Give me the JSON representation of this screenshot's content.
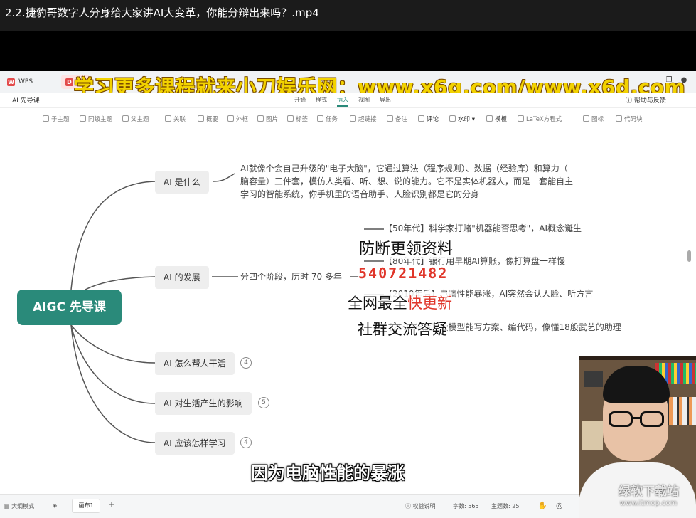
{
  "video": {
    "title": "2.2.捷豹哥数字人分身给大家讲AI大变革，你能分辩出来吗？.mp4"
  },
  "watermark": "学习更多课程就来小刀娱乐网：www.x6g.com/www.x6d.com",
  "titlebar": {
    "tabs": [
      {
        "label": "WPS Office",
        "icon": "wps-logo-icon"
      },
      {
        "label": "",
        "icon": "document-icon"
      }
    ]
  },
  "menubar": {
    "doc_name": "AI 先导课",
    "items": [
      "开始",
      "样式",
      "插入",
      "视图",
      "导出"
    ],
    "active": "插入",
    "help": "帮助与反馈"
  },
  "toolbar": {
    "items": [
      "子主题",
      "同级主题",
      "父主题",
      "关联",
      "概要",
      "外框",
      "图片",
      "标签",
      "任务",
      "超链接",
      "备注",
      "评论",
      "水印",
      "模板",
      "LaTeX方程式",
      "图标",
      "代码块"
    ]
  },
  "mindmap": {
    "root": "AIGC 先导课",
    "branches": [
      {
        "label": "AI 是什么",
        "count": null
      },
      {
        "label": "AI 的发展",
        "count": null
      },
      {
        "label": "AI 怎么帮人干活",
        "count": "4"
      },
      {
        "label": "AI 对生活产生的影响",
        "count": "5"
      },
      {
        "label": "AI 应该怎样学习",
        "count": "4"
      }
    ],
    "what_is_ai": [
      "AI就像个会自己升级的\"电子大脑\"，它通过算法（程序规则）、数据（经验库）和算力（",
      "脑容量）三件套，模仿人类看、听、想、说的能力。它不是实体机器人，而是一套能自主",
      "学习的智能系统，你手机里的语音助手、人脸识别都是它的分身"
    ],
    "development_summary": "分四个阶段，历时 70 多年",
    "stages": [
      "【50年代】科学家打赌\"机器能否思考\"，AI概念诞生",
      "【80年代】银行用早期AI算账，像打算盘一样慢",
      "【2010年后】电脑性能暴涨，AI突然会认人脸、听方言",
      "【2020年后】大模型能写方案、编代码，像懂18般武艺的助理"
    ]
  },
  "overlay": {
    "line1": "防断更领资料",
    "line2": "540721482",
    "line3_prefix": "全网最全",
    "line3_red": "快更新",
    "line4": "社群交流答疑"
  },
  "subtitle": "因为电脑性能的暴涨",
  "statusbar": {
    "outline_mode": "大纲模式",
    "sheet": "画布1",
    "add": "+",
    "rights": "权益说明",
    "word_count_label": "字数:",
    "word_count": "565",
    "topic_count_label": "主题数:",
    "topic_count": "25"
  },
  "webcam": {
    "site_logo": "绿软下载站",
    "site_url": "www.itmop.com"
  },
  "colors": {
    "accent": "#2a8a7a",
    "watermark": "#f2d200",
    "overlay_red": "#e0362a"
  }
}
